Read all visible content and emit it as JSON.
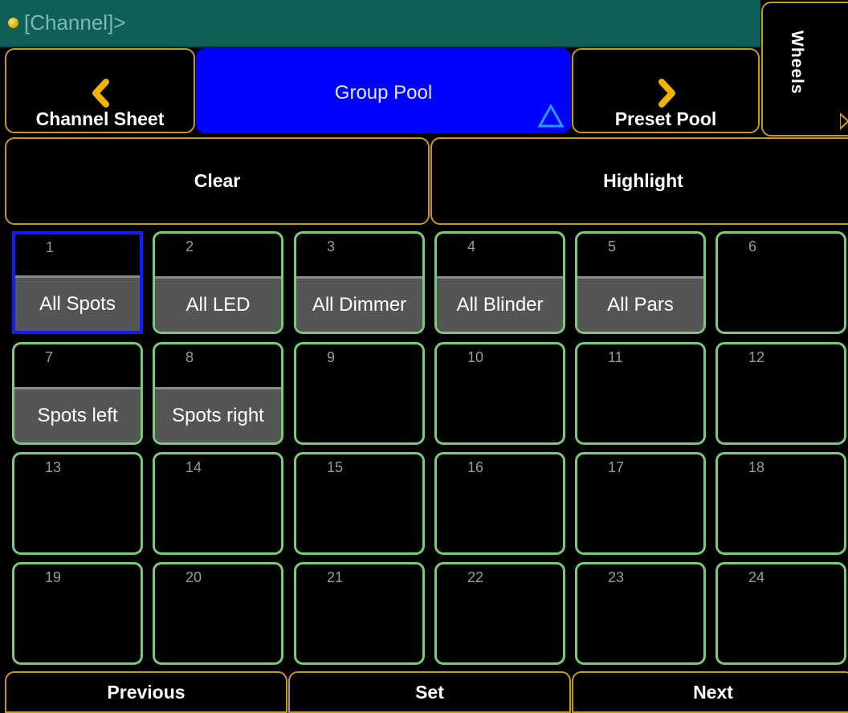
{
  "command_line": {
    "text": "[Channel]>"
  },
  "side_tab": {
    "label": "Wheels"
  },
  "nav": {
    "prev_label": "Channel Sheet",
    "current_label": "Group Pool",
    "next_label": "Preset Pool"
  },
  "actions": {
    "clear": "Clear",
    "highlight": "Highlight"
  },
  "pool": [
    {
      "num": "1",
      "name": "All Spots",
      "selected": true
    },
    {
      "num": "2",
      "name": "All LED"
    },
    {
      "num": "3",
      "name": "All Dimmer"
    },
    {
      "num": "4",
      "name": "All Blinder"
    },
    {
      "num": "5",
      "name": "All Pars"
    },
    {
      "num": "6",
      "name": ""
    },
    {
      "num": "7",
      "name": "Spots left"
    },
    {
      "num": "8",
      "name": "Spots right"
    },
    {
      "num": "9",
      "name": ""
    },
    {
      "num": "10",
      "name": ""
    },
    {
      "num": "11",
      "name": ""
    },
    {
      "num": "12",
      "name": ""
    },
    {
      "num": "13",
      "name": ""
    },
    {
      "num": "14",
      "name": ""
    },
    {
      "num": "15",
      "name": ""
    },
    {
      "num": "16",
      "name": ""
    },
    {
      "num": "17",
      "name": ""
    },
    {
      "num": "18",
      "name": ""
    },
    {
      "num": "19",
      "name": ""
    },
    {
      "num": "20",
      "name": ""
    },
    {
      "num": "21",
      "name": ""
    },
    {
      "num": "22",
      "name": ""
    },
    {
      "num": "23",
      "name": ""
    },
    {
      "num": "24",
      "name": ""
    }
  ],
  "bottom": {
    "previous": "Previous",
    "set": "Set",
    "next": "Next"
  },
  "colors": {
    "accent": "#c89a19",
    "pool_border": "#77cc77",
    "selected": "#0a1fff",
    "active_tab": "#0000ff",
    "command_bg": "#0e5f56"
  },
  "icons": {
    "status": "status-dot-icon",
    "left": "chevron-left-icon",
    "right": "chevron-right-icon",
    "up": "triangle-up-icon"
  }
}
